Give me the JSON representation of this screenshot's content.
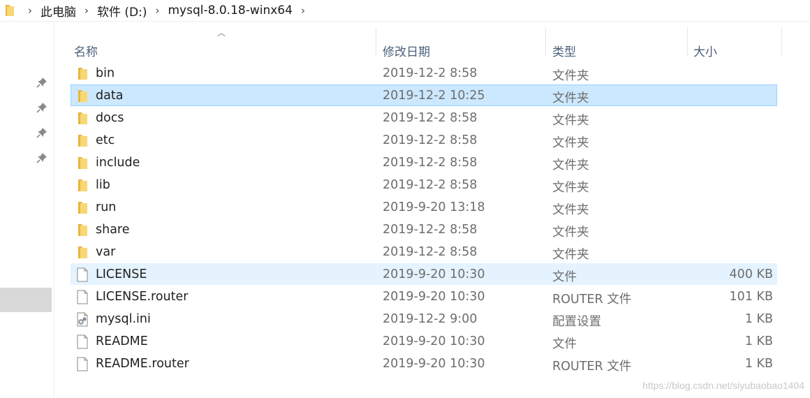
{
  "breadcrumb": {
    "items": [
      "此电脑",
      "软件 (D:)",
      "mysql-8.0.18-winx64"
    ]
  },
  "columns": {
    "name": "名称",
    "date": "修改日期",
    "type": "类型",
    "size": "大小"
  },
  "files": [
    {
      "name": "bin",
      "date": "2019-12-2 8:58",
      "type": "文件夹",
      "size": "",
      "icon": "folder-icon"
    },
    {
      "name": "data",
      "date": "2019-12-2 10:25",
      "type": "文件夹",
      "size": "",
      "icon": "folder-icon",
      "state": "selected"
    },
    {
      "name": "docs",
      "date": "2019-12-2 8:58",
      "type": "文件夹",
      "size": "",
      "icon": "folder-icon"
    },
    {
      "name": "etc",
      "date": "2019-12-2 8:58",
      "type": "文件夹",
      "size": "",
      "icon": "folder-icon"
    },
    {
      "name": "include",
      "date": "2019-12-2 8:58",
      "type": "文件夹",
      "size": "",
      "icon": "folder-icon"
    },
    {
      "name": "lib",
      "date": "2019-12-2 8:58",
      "type": "文件夹",
      "size": "",
      "icon": "folder-icon"
    },
    {
      "name": "run",
      "date": "2019-9-20 13:18",
      "type": "文件夹",
      "size": "",
      "icon": "folder-icon"
    },
    {
      "name": "share",
      "date": "2019-12-2 8:58",
      "type": "文件夹",
      "size": "",
      "icon": "folder-icon"
    },
    {
      "name": "var",
      "date": "2019-12-2 8:58",
      "type": "文件夹",
      "size": "",
      "icon": "folder-icon"
    },
    {
      "name": "LICENSE",
      "date": "2019-9-20 10:30",
      "type": "文件",
      "size": "400 KB",
      "icon": "file-icon",
      "state": "hover"
    },
    {
      "name": "LICENSE.router",
      "date": "2019-9-20 10:30",
      "type": "ROUTER 文件",
      "size": "101 KB",
      "icon": "file-icon"
    },
    {
      "name": "mysql.ini",
      "date": "2019-12-2 9:00",
      "type": "配置设置",
      "size": "1 KB",
      "icon": "settings-file-icon"
    },
    {
      "name": "README",
      "date": "2019-9-20 10:30",
      "type": "文件",
      "size": "1 KB",
      "icon": "file-icon"
    },
    {
      "name": "README.router",
      "date": "2019-9-20 10:30",
      "type": "ROUTER 文件",
      "size": "1 KB",
      "icon": "file-icon"
    }
  ],
  "watermark": "https://blog.csdn.net/siyubaobao1404",
  "colors": {
    "selected_bg": "#cce8ff",
    "selected_border": "#99d1ff",
    "hover_bg": "#e5f3ff",
    "folder_yellow": "#f8d775",
    "header_text": "#4c607a"
  }
}
